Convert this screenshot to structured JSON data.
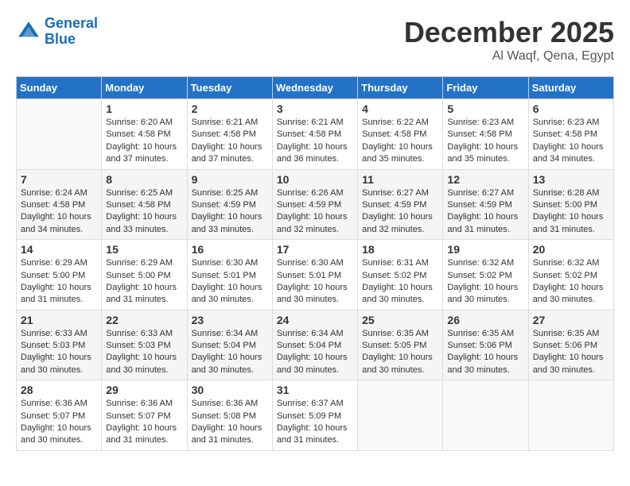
{
  "header": {
    "logo_line1": "General",
    "logo_line2": "Blue",
    "month": "December 2025",
    "location": "Al Waqf, Qena, Egypt"
  },
  "days_of_week": [
    "Sunday",
    "Monday",
    "Tuesday",
    "Wednesday",
    "Thursday",
    "Friday",
    "Saturday"
  ],
  "weeks": [
    [
      {
        "num": "",
        "info": ""
      },
      {
        "num": "1",
        "info": "Sunrise: 6:20 AM\nSunset: 4:58 PM\nDaylight: 10 hours\nand 37 minutes."
      },
      {
        "num": "2",
        "info": "Sunrise: 6:21 AM\nSunset: 4:58 PM\nDaylight: 10 hours\nand 37 minutes."
      },
      {
        "num": "3",
        "info": "Sunrise: 6:21 AM\nSunset: 4:58 PM\nDaylight: 10 hours\nand 36 minutes."
      },
      {
        "num": "4",
        "info": "Sunrise: 6:22 AM\nSunset: 4:58 PM\nDaylight: 10 hours\nand 35 minutes."
      },
      {
        "num": "5",
        "info": "Sunrise: 6:23 AM\nSunset: 4:58 PM\nDaylight: 10 hours\nand 35 minutes."
      },
      {
        "num": "6",
        "info": "Sunrise: 6:23 AM\nSunset: 4:58 PM\nDaylight: 10 hours\nand 34 minutes."
      }
    ],
    [
      {
        "num": "7",
        "info": "Sunrise: 6:24 AM\nSunset: 4:58 PM\nDaylight: 10 hours\nand 34 minutes."
      },
      {
        "num": "8",
        "info": "Sunrise: 6:25 AM\nSunset: 4:58 PM\nDaylight: 10 hours\nand 33 minutes."
      },
      {
        "num": "9",
        "info": "Sunrise: 6:25 AM\nSunset: 4:59 PM\nDaylight: 10 hours\nand 33 minutes."
      },
      {
        "num": "10",
        "info": "Sunrise: 6:26 AM\nSunset: 4:59 PM\nDaylight: 10 hours\nand 32 minutes."
      },
      {
        "num": "11",
        "info": "Sunrise: 6:27 AM\nSunset: 4:59 PM\nDaylight: 10 hours\nand 32 minutes."
      },
      {
        "num": "12",
        "info": "Sunrise: 6:27 AM\nSunset: 4:59 PM\nDaylight: 10 hours\nand 31 minutes."
      },
      {
        "num": "13",
        "info": "Sunrise: 6:28 AM\nSunset: 5:00 PM\nDaylight: 10 hours\nand 31 minutes."
      }
    ],
    [
      {
        "num": "14",
        "info": "Sunrise: 6:29 AM\nSunset: 5:00 PM\nDaylight: 10 hours\nand 31 minutes."
      },
      {
        "num": "15",
        "info": "Sunrise: 6:29 AM\nSunset: 5:00 PM\nDaylight: 10 hours\nand 31 minutes."
      },
      {
        "num": "16",
        "info": "Sunrise: 6:30 AM\nSunset: 5:01 PM\nDaylight: 10 hours\nand 30 minutes."
      },
      {
        "num": "17",
        "info": "Sunrise: 6:30 AM\nSunset: 5:01 PM\nDaylight: 10 hours\nand 30 minutes."
      },
      {
        "num": "18",
        "info": "Sunrise: 6:31 AM\nSunset: 5:02 PM\nDaylight: 10 hours\nand 30 minutes."
      },
      {
        "num": "19",
        "info": "Sunrise: 6:32 AM\nSunset: 5:02 PM\nDaylight: 10 hours\nand 30 minutes."
      },
      {
        "num": "20",
        "info": "Sunrise: 6:32 AM\nSunset: 5:02 PM\nDaylight: 10 hours\nand 30 minutes."
      }
    ],
    [
      {
        "num": "21",
        "info": "Sunrise: 6:33 AM\nSunset: 5:03 PM\nDaylight: 10 hours\nand 30 minutes."
      },
      {
        "num": "22",
        "info": "Sunrise: 6:33 AM\nSunset: 5:03 PM\nDaylight: 10 hours\nand 30 minutes."
      },
      {
        "num": "23",
        "info": "Sunrise: 6:34 AM\nSunset: 5:04 PM\nDaylight: 10 hours\nand 30 minutes."
      },
      {
        "num": "24",
        "info": "Sunrise: 6:34 AM\nSunset: 5:04 PM\nDaylight: 10 hours\nand 30 minutes."
      },
      {
        "num": "25",
        "info": "Sunrise: 6:35 AM\nSunset: 5:05 PM\nDaylight: 10 hours\nand 30 minutes."
      },
      {
        "num": "26",
        "info": "Sunrise: 6:35 AM\nSunset: 5:06 PM\nDaylight: 10 hours\nand 30 minutes."
      },
      {
        "num": "27",
        "info": "Sunrise: 6:35 AM\nSunset: 5:06 PM\nDaylight: 10 hours\nand 30 minutes."
      }
    ],
    [
      {
        "num": "28",
        "info": "Sunrise: 6:36 AM\nSunset: 5:07 PM\nDaylight: 10 hours\nand 30 minutes."
      },
      {
        "num": "29",
        "info": "Sunrise: 6:36 AM\nSunset: 5:07 PM\nDaylight: 10 hours\nand 31 minutes."
      },
      {
        "num": "30",
        "info": "Sunrise: 6:36 AM\nSunset: 5:08 PM\nDaylight: 10 hours\nand 31 minutes."
      },
      {
        "num": "31",
        "info": "Sunrise: 6:37 AM\nSunset: 5:09 PM\nDaylight: 10 hours\nand 31 minutes."
      },
      {
        "num": "",
        "info": ""
      },
      {
        "num": "",
        "info": ""
      },
      {
        "num": "",
        "info": ""
      }
    ]
  ]
}
